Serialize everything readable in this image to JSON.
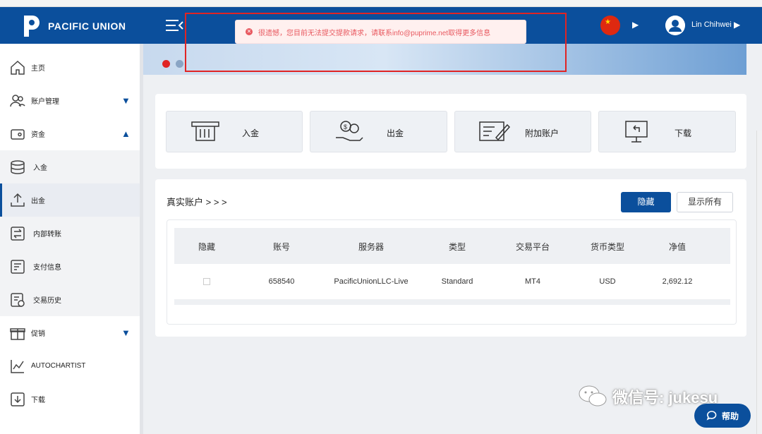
{
  "header": {
    "brand": "PACIFIC UNION",
    "user_name": "Lin Chihwei"
  },
  "alert": {
    "message": "很遗憾，您目前无法提交提款请求，请联系info@puprime.net取得更多信息"
  },
  "sidebar": {
    "items": [
      {
        "label": "主页",
        "icon": "home-icon"
      },
      {
        "label": "账户管理",
        "icon": "users-icon"
      },
      {
        "label": "资金",
        "icon": "wallet-icon"
      },
      {
        "label": "入金",
        "icon": "coins-icon"
      },
      {
        "label": "出金",
        "icon": "upload-icon"
      },
      {
        "label": "内部转账",
        "icon": "transfer-icon"
      },
      {
        "label": "支付信息",
        "icon": "payment-info-icon"
      },
      {
        "label": "交易历史",
        "icon": "history-icon"
      },
      {
        "label": "促销",
        "icon": "gift-icon"
      },
      {
        "label": "AUTOCHARTIST",
        "icon": "chart-icon"
      },
      {
        "label": "下载",
        "icon": "download-icon"
      }
    ]
  },
  "quick_actions": {
    "deposit": "入金",
    "withdraw": "出金",
    "add_account": "附加账户",
    "download": "下载"
  },
  "accounts": {
    "title": "真实账户 > > >",
    "hide_button": "隐藏",
    "show_all_button": "显示所有",
    "columns": [
      "隐藏",
      "账号",
      "服务器",
      "类型",
      "交易平台",
      "货币类型",
      "净值"
    ],
    "rows": [
      [
        "",
        "658540",
        "PacificUnionLLC-Live",
        "Standard",
        "MT4",
        "USD",
        "2,692.12"
      ]
    ]
  },
  "watermark": {
    "wechat": "微信号: jukesu"
  },
  "help_button": "帮助",
  "colors": {
    "brand": "#0b4f9c",
    "alert_text": "#e8585f",
    "annotation_frame": "#e02424"
  }
}
